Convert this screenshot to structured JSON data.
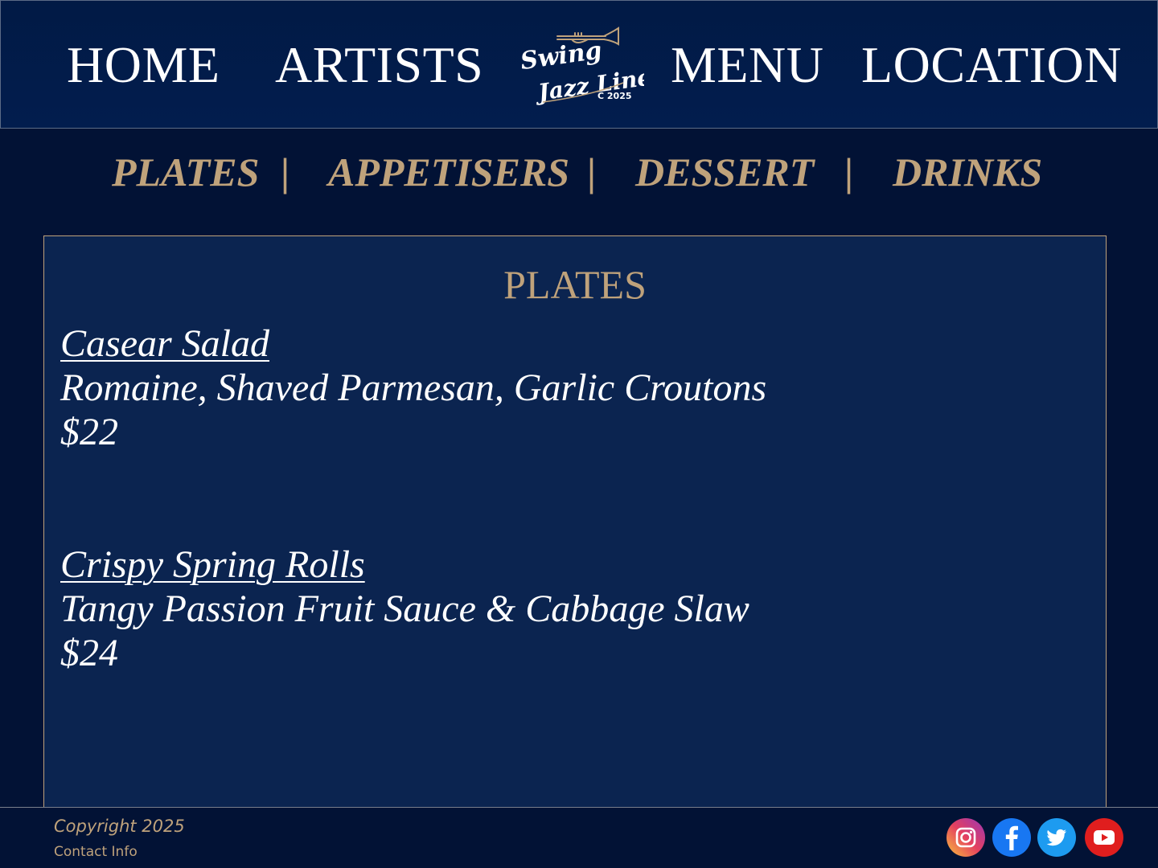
{
  "header": {
    "nav": {
      "home": "HOME",
      "artists": "ARTISTS",
      "menu": "MENU",
      "location": "LOCATION"
    },
    "logo": {
      "line1": "Swing",
      "line2": "Jazz Line",
      "year": "C 2025"
    }
  },
  "subnav": {
    "items": [
      "PLATES",
      "APPETISERS",
      "DESSERT",
      "DRINKS"
    ],
    "separator": "|"
  },
  "panel": {
    "title": "PLATES",
    "dishes": [
      {
        "name": "Casear Salad",
        "description": "Romaine, Shaved Parmesan, Garlic Croutons",
        "price": "$22"
      },
      {
        "name": "Crispy Spring Rolls",
        "description": "Tangy Passion Fruit Sauce & Cabbage Slaw",
        "price": "$24"
      }
    ]
  },
  "footer": {
    "copyright": "Copyright 2025",
    "contact": "Contact Info",
    "social": [
      "instagram-icon",
      "facebook-icon",
      "twitter-icon",
      "youtube-icon"
    ]
  },
  "colors": {
    "background": "#021235",
    "header": "#011a45",
    "panel": "#0b2450",
    "accent_gold": "#bfa27b",
    "text": "#ffffff"
  }
}
